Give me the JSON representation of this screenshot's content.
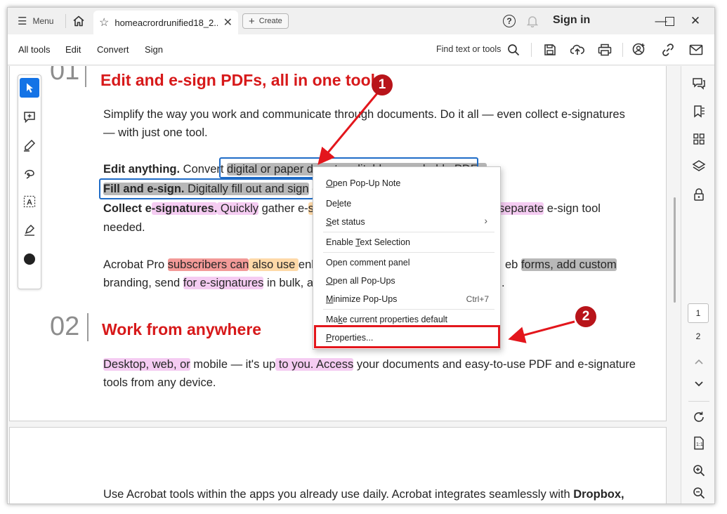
{
  "titlebar": {
    "menu_label": "Menu",
    "tab_title": "homeacrordrunified18_2...",
    "create_label": "Create",
    "signin_label": "Sign in"
  },
  "toolbar": {
    "nav": [
      "All tools",
      "Edit",
      "Convert",
      "Sign"
    ],
    "find_label": "Find text or tools"
  },
  "document": {
    "section1_num": "01",
    "section1_heading": "Edit and e-sign PDFs, all in one tool",
    "intro_line1": "Simplify the way you work and communicate through documents. Do it all — even collect e-signatures",
    "intro_line2": "— with just one tool.",
    "edit_bold": "Edit anything.",
    "edit_text1": " Convert ",
    "edit_hl": "digital or paper docs to editable, searchable PDFs.",
    "fill_bold": "Fill and e-sign.",
    "fill_hl": " Digitally fill out and sign",
    "fill_tail": " e",
    "collect_bold_a": "Collect e",
    "collect_bold_b": "-signatures.",
    "collect_text": " Quickly",
    "collect_text2": " gather e-",
    "collect_hl": "sig",
    "collect_tail_hl": "separate",
    "collect_tail": " e-sign tool",
    "needed": "needed.",
    "pro_line1_a": "Acrobat Pro ",
    "pro_line1_hl_red": "subscribers can",
    "pro_line1_hl_orange": " also use ",
    "pro_line1_b": "enha",
    "pro_line1_c": "eb ",
    "pro_line1_hl_gray": "forms, add custom",
    "pro_line2_a": "branding, send ",
    "pro_line2_hl": "for e-signatures",
    "pro_line2_b": " in bulk, an",
    "pro_line2_c": ".",
    "section2_num": "02",
    "section2_heading": "Work from anywhere",
    "work_hl1": "Desktop, web, or",
    "work_text1": " mobile — it's up",
    "work_hl2": " to you. Access",
    "work_text2": " your documents and easy-to-use PDF and e-signature",
    "work_line2": "tools from any device.",
    "page2_text_a": "Use Acrobat tools within the apps you already use daily. Acrobat integrates seamlessly with ",
    "page2_text_b": "Dropbox,"
  },
  "context_menu": {
    "items": [
      {
        "label": "Open Pop-Up Note",
        "u": "O"
      },
      {
        "label": "Delete",
        "u": "l"
      },
      {
        "label": "Set status",
        "u": "S"
      },
      {
        "label": "Enable Text Selection",
        "u": "T"
      },
      {
        "label": "Open comment panel",
        "u": ""
      },
      {
        "label": "Open all Pop-Ups",
        "u": "O"
      },
      {
        "label": "Minimize Pop-Ups",
        "u": "M"
      },
      {
        "label": "Make current properties default",
        "u": "k"
      },
      {
        "label": "Properties...",
        "u": "P"
      }
    ],
    "minimize_shortcut": "Ctrl+7"
  },
  "right_panel": {
    "current_page": "1",
    "total_pages": "2"
  },
  "annotations": {
    "badge1": "1",
    "badge2": "2",
    "arrow_color": "#e3161c"
  },
  "colors": {
    "accent": "#1473e6",
    "heading_red": "#d7191a",
    "annotation_red": "#e3161c"
  }
}
